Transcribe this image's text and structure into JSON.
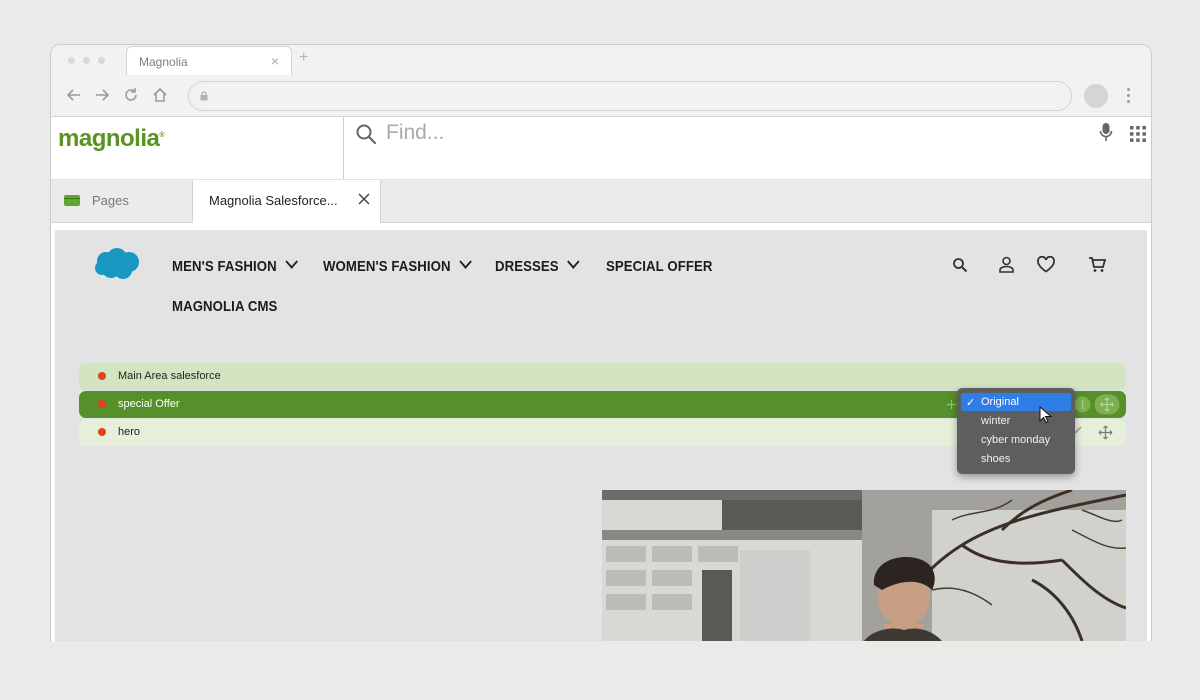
{
  "browser": {
    "tab_title": "Magnolia",
    "tab_close": "×",
    "new_tab": "+"
  },
  "app": {
    "logo": "magnolia",
    "logo_mark": "®",
    "search_placeholder": "Find...",
    "tabs": [
      {
        "label": "Pages"
      },
      {
        "label": "Magnolia Salesforce..."
      }
    ]
  },
  "site": {
    "nav": [
      {
        "label": "MEN'S FASHION",
        "has_dropdown": true
      },
      {
        "label": "WOMEN'S FASHION",
        "has_dropdown": true
      },
      {
        "label": "DRESSES",
        "has_dropdown": true
      },
      {
        "label": "SPECIAL OFFER",
        "has_dropdown": false
      },
      {
        "label": "MAGNOLIA CMS",
        "has_dropdown": false
      }
    ],
    "icons": [
      "search-icon",
      "user-icon",
      "heart-icon",
      "cart-icon"
    ],
    "brand_color": "#1798c1"
  },
  "editor": {
    "rows": [
      {
        "label": "Main Area salesforce"
      },
      {
        "label": "special Offer"
      },
      {
        "label": "hero"
      }
    ],
    "variant_dropdown": {
      "selected": "Original",
      "check": "✓",
      "options": [
        "Original",
        "winter",
        "cyber monday",
        "shoes"
      ]
    },
    "accent_color": "#56902a",
    "status_dot_color": "#e0421c"
  }
}
